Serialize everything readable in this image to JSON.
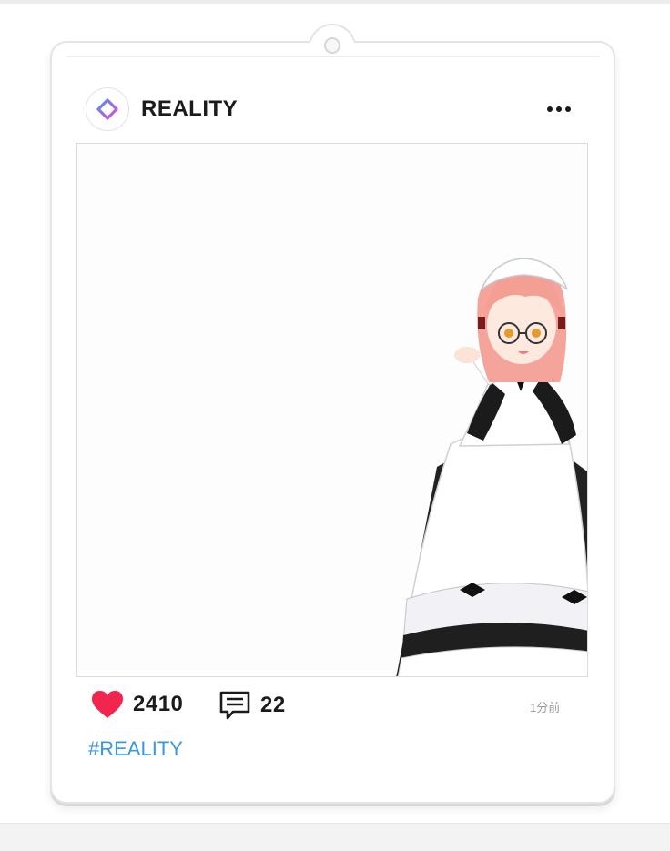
{
  "post": {
    "username": "REALITY",
    "avatar_icon": "reality-logo-icon",
    "more_icon": "more-horizontal-icon",
    "image_subject": "maid-character-illustration",
    "likes": "2410",
    "like_icon": "heart-icon",
    "comments": "22",
    "comment_icon": "comment-icon",
    "time_ago": "1分前",
    "hashtag": "#REALITY"
  },
  "colors": {
    "like": "#f0264e",
    "hashtag": "#3a98db",
    "logo_gradient_start": "#4f8df7",
    "logo_gradient_end": "#e251c4"
  }
}
